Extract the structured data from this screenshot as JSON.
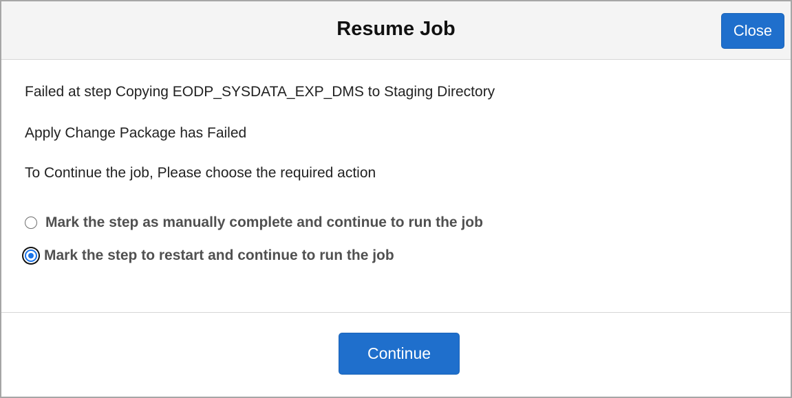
{
  "dialog": {
    "title": "Resume Job",
    "close_label": "Close",
    "messages": [
      "Failed at step Copying EODP_SYSDATA_EXP_DMS to Staging Directory",
      "Apply Change Package has Failed",
      "To Continue the job, Please choose the required action"
    ],
    "options": [
      {
        "label": "Mark the step as manually complete and continue to run the job",
        "selected": false
      },
      {
        "label": "Mark the step to restart and continue to run the job",
        "selected": true
      }
    ],
    "continue_label": "Continue"
  },
  "colors": {
    "primary_button": "#1f6fcc",
    "header_background": "#f4f4f4",
    "radio_selected": "#1a73e8"
  }
}
